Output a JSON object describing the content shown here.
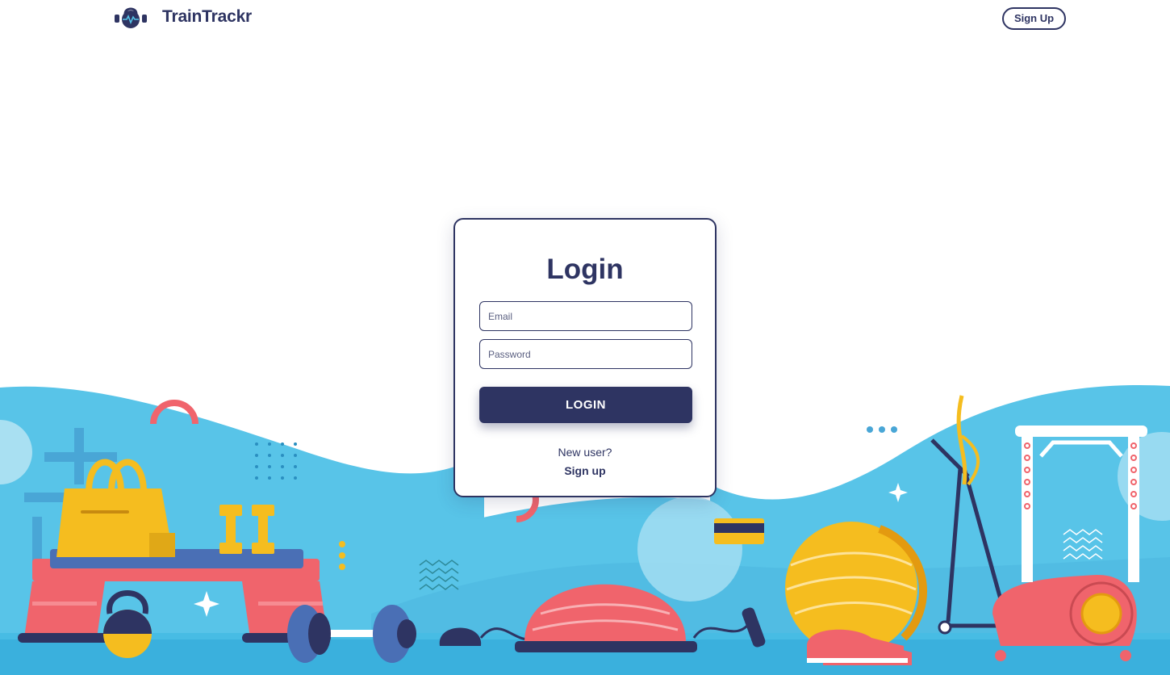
{
  "brand": {
    "name": "TrainTrackr",
    "logo_icon": "kettlebell-heartbeat-icon"
  },
  "header": {
    "signup_label": "Sign Up"
  },
  "login": {
    "title": "Login",
    "email_placeholder": "Email",
    "password_placeholder": "Password",
    "button_label": "LOGIN",
    "new_user_text": "New user?",
    "signup_link": "Sign up"
  },
  "colors": {
    "primary": "#2e3462",
    "sky": "#55c3e6",
    "floor": "#3ab0dd",
    "coral": "#f0646c",
    "yellow": "#f5bd1f"
  }
}
